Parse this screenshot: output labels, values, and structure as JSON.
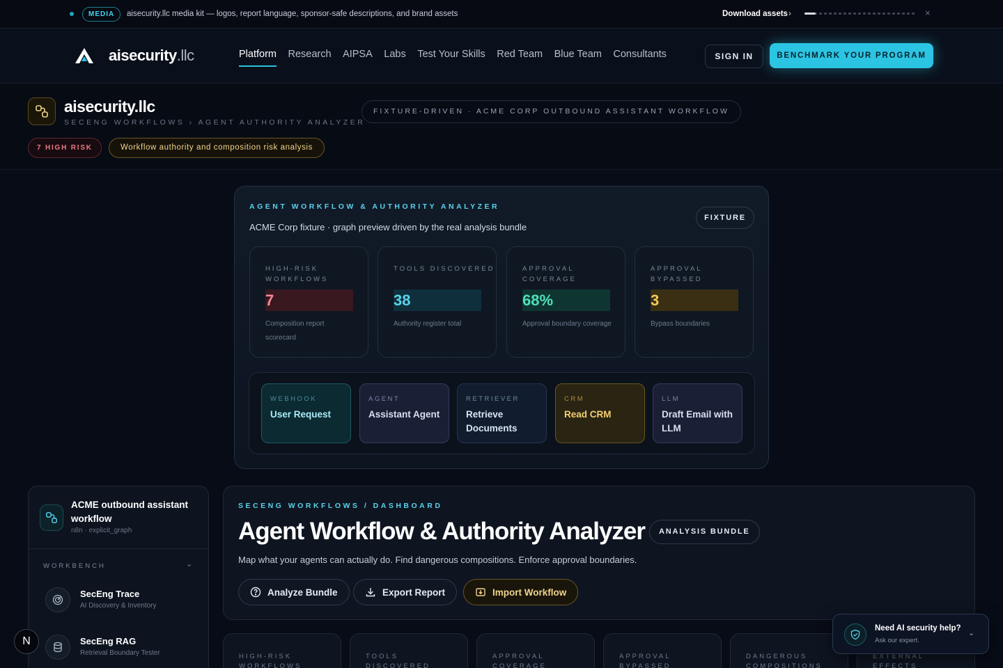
{
  "announcement": {
    "tag": "MEDIA",
    "message": "aisecurity.llc media kit — logos, report language, sponsor-safe descriptions, and brand assets",
    "link_label": "Download assets",
    "chevron": "›",
    "close": "×",
    "progress": 0.1
  },
  "nav": {
    "logo_main": "aisecurity",
    "logo_tld": ".llc",
    "links": [
      "Platform",
      "Research",
      "AIPSA",
      "Labs",
      "Test Your Skills",
      "Red Team",
      "Blue Team",
      "Consultants"
    ],
    "active_link": "Platform",
    "sign_in": "SIGN IN",
    "cta": "BENCHMARK YOUR PROGRAM"
  },
  "product_header": {
    "title": "aisecurity.llc",
    "breadcrumb": "SECENG WORKFLOWS › AGENT AUTHORITY ANALYZER",
    "risk_badge": "7 HIGH RISK",
    "description_badge": "Workflow authority and composition risk analysis",
    "fixture_pill": "FIXTURE-DRIVEN · ACME CORP OUTBOUND ASSISTANT WORKFLOW"
  },
  "preview": {
    "kicker": "AGENT WORKFLOW & AUTHORITY ANALYZER",
    "subtitle": "ACME Corp fixture · graph preview driven by the real analysis bundle",
    "fixture_button": "FIXTURE",
    "stats": [
      {
        "label": "HIGH-RISK WORKFLOWS",
        "value": "7",
        "caption": "Composition report scorecard",
        "color": "#f58b93",
        "bg": "#3a1820"
      },
      {
        "label": "TOOLS DISCOVERED",
        "value": "38",
        "caption": "Authority register total",
        "color": "#59d3ec",
        "bg": "#0f2f3c"
      },
      {
        "label": "APPROVAL COVERAGE",
        "value": "68%",
        "caption": "Approval boundary coverage",
        "color": "#4fe0bb",
        "bg": "#0f3530"
      },
      {
        "label": "APPROVAL BYPASSED",
        "value": "3",
        "caption": "Bypass boundaries",
        "color": "#f4c95a",
        "bg": "#3a2f12"
      }
    ],
    "flow_nodes": [
      {
        "type": "WEBHOOK",
        "name": "User Request",
        "type_color": "#4b8fa0",
        "name_color": "#a9ecf8",
        "border": "#1d5a66",
        "bg": "#0c2a31"
      },
      {
        "type": "AGENT",
        "name": "Assistant Agent",
        "type_color": "#7d86a6",
        "name_color": "#d9def0",
        "border": "#333c5c",
        "bg": "#1a1f36"
      },
      {
        "type": "RETRIEVER",
        "name": "Retrieve Documents",
        "type_color": "#6f86a0",
        "name_color": "#d7e4f2",
        "border": "#22344e",
        "bg": "#111d2f"
      },
      {
        "type": "CRM",
        "name": "Read CRM",
        "type_color": "#b08f3e",
        "name_color": "#f4cf72",
        "border": "#6b5620",
        "bg": "#2a2412"
      },
      {
        "type": "LLM",
        "name": "Draft Email with LLM",
        "type_color": "#7d86a6",
        "name_color": "#d9def0",
        "border": "#333c5c",
        "bg": "#1a1f36"
      }
    ]
  },
  "sidebar": {
    "project_name": "ACME outbound assistant workflow",
    "project_meta": "n8n · explicit_graph",
    "section": "WORKBENCH",
    "tools": [
      {
        "name": "SecEng Trace",
        "desc": "AI Discovery & Inventory",
        "icon": "radar-icon"
      },
      {
        "name": "SecEng RAG",
        "desc": "Retrieval Boundary Tester",
        "icon": "database-icon"
      }
    ],
    "avatar_letter": "N"
  },
  "dashboard": {
    "kicker": "SECENG WORKFLOWS / DASHBOARD",
    "title": "Agent Workflow & Authority Analyzer",
    "bundle_badge": "ANALYSIS BUNDLE",
    "description": "Map what your agents can actually do. Find dangerous compositions. Enforce approval boundaries.",
    "buttons": {
      "analyze": "Analyze Bundle",
      "export": "Export Report",
      "import": "Import Workflow"
    }
  },
  "bottom_stats": [
    "HIGH-RISK WORKFLOWS",
    "TOOLS DISCOVERED",
    "APPROVAL COVERAGE",
    "APPROVAL BYPASSED",
    "DANGEROUS COMPOSITIONS",
    "EXTERNAL EFFECTS"
  ],
  "help_widget": {
    "title": "Need AI security help?",
    "subtitle": "Ask our expert."
  },
  "colors": {
    "accent": "#2cc4e3",
    "gold": "#f0d48a",
    "risk": "#f07986",
    "background": "#080c16"
  }
}
